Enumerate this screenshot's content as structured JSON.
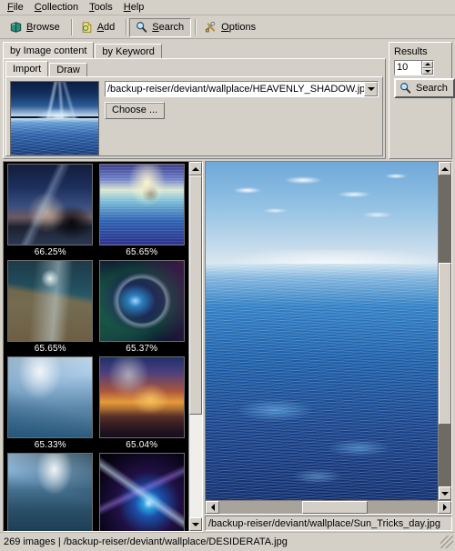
{
  "menu": {
    "items": [
      {
        "label": "File",
        "mnemonic": "F"
      },
      {
        "label": "Collection",
        "mnemonic": "C"
      },
      {
        "label": "Tools",
        "mnemonic": "T"
      },
      {
        "label": "Help",
        "mnemonic": "H"
      }
    ]
  },
  "toolbar": {
    "buttons": [
      {
        "label": "Browse",
        "mnemonic": "B",
        "icon": "book-icon",
        "active": false
      },
      {
        "label": "Add",
        "mnemonic": "A",
        "icon": "page-add-icon",
        "active": false
      },
      {
        "label": "Search",
        "mnemonic": "S",
        "icon": "magnifier-icon",
        "active": true
      },
      {
        "label": "Options",
        "mnemonic": "O",
        "icon": "tools-icon",
        "active": false
      }
    ]
  },
  "search": {
    "tabs": [
      {
        "label": "by Image content",
        "selected": true
      },
      {
        "label": "by Keyword",
        "selected": false
      }
    ],
    "subtabs": [
      {
        "label": "Import",
        "selected": true
      },
      {
        "label": "Draw",
        "selected": false
      }
    ],
    "path_value": "/backup-reiser/deviant/wallplace/HEAVENLY_SHADOW.jpg",
    "choose_label": "Choose ...",
    "results_label": "Results",
    "results_count": "10",
    "search_button_label": "Search"
  },
  "results": {
    "thumbnails": [
      {
        "score": "66.25%",
        "art": "t1"
      },
      {
        "score": "65.65%",
        "art": "t2"
      },
      {
        "score": "65.65%",
        "art": "t3"
      },
      {
        "score": "65.37%",
        "art": "t4"
      },
      {
        "score": "65.33%",
        "art": "t5"
      },
      {
        "score": "65.04%",
        "art": "t6"
      },
      {
        "score": "",
        "art": "t7"
      },
      {
        "score": "",
        "art": "t8"
      }
    ]
  },
  "viewer": {
    "path": "/backup-reiser/deviant/wallplace/Sun_Tricks_day.jpg"
  },
  "statusbar": {
    "text": "269 images | /backup-reiser/deviant/wallplace/DESIDERATA.jpg"
  },
  "colors": {
    "face": "#d4d0c8",
    "shadow": "#808080",
    "light": "#ffffff",
    "canvas": "#000000"
  }
}
